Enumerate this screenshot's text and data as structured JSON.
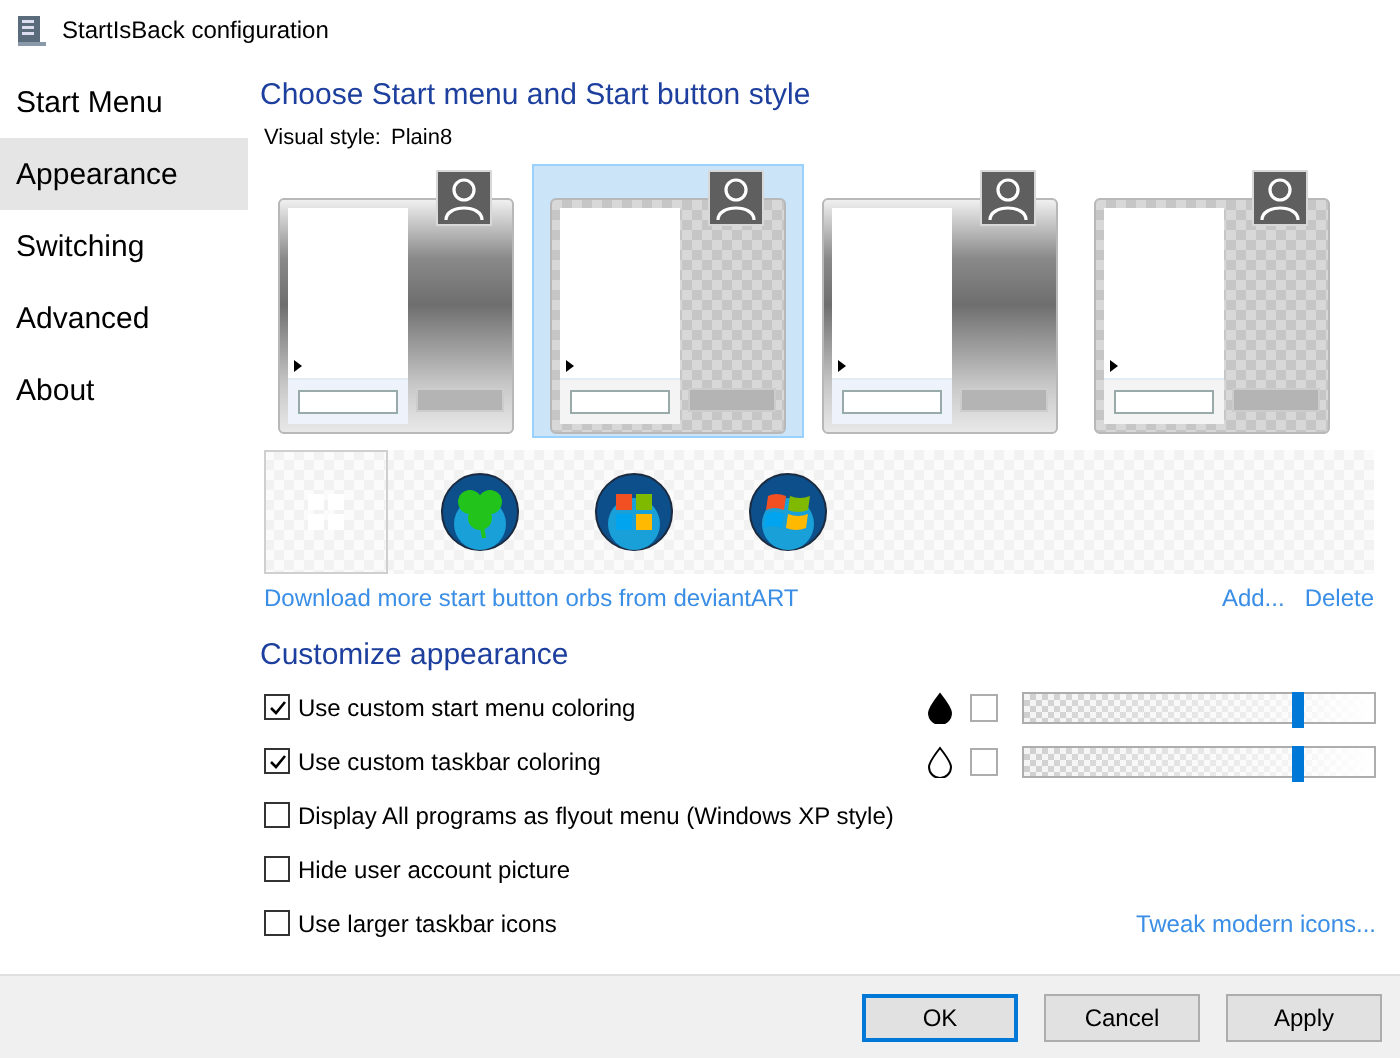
{
  "window": {
    "title": "StartIsBack configuration"
  },
  "sidebar": {
    "items": [
      {
        "label": "Start Menu",
        "selected": false
      },
      {
        "label": "Appearance",
        "selected": true
      },
      {
        "label": "Switching",
        "selected": false
      },
      {
        "label": "Advanced",
        "selected": false
      },
      {
        "label": "About",
        "selected": false
      }
    ]
  },
  "style_section": {
    "title": "Choose Start menu and Start button style",
    "visual_style_label": "Visual style:",
    "visual_style_value": "Plain8",
    "styles": [
      {
        "kind": "gradient",
        "selected": false
      },
      {
        "kind": "checker",
        "selected": true
      },
      {
        "kind": "gradient",
        "selected": false
      },
      {
        "kind": "checker",
        "selected": false
      }
    ],
    "orbs": [
      {
        "kind": "tiles",
        "selected": true
      },
      {
        "kind": "clover",
        "selected": false
      },
      {
        "kind": "flag",
        "selected": false
      },
      {
        "kind": "wave",
        "selected": false
      }
    ],
    "download_link": "Download more start button orbs from deviantART",
    "add_link": "Add...",
    "delete_link": "Delete"
  },
  "customize": {
    "title": "Customize appearance",
    "options": [
      {
        "label": "Use custom start menu coloring",
        "checked": true,
        "kind": "color",
        "drop_filled": true,
        "level": 0.78
      },
      {
        "label": "Use custom taskbar coloring",
        "checked": true,
        "kind": "color",
        "drop_filled": false,
        "level": 0.78
      },
      {
        "label": "Display All programs as flyout menu (Windows XP style)",
        "checked": false,
        "kind": "plain"
      },
      {
        "label": "Hide user account picture",
        "checked": false,
        "kind": "plain"
      },
      {
        "label": "Use larger taskbar icons",
        "checked": false,
        "kind": "link",
        "link": "Tweak modern icons..."
      }
    ]
  },
  "buttons": [
    {
      "label": "OK",
      "default": true
    },
    {
      "label": "Cancel",
      "default": false
    },
    {
      "label": "Apply",
      "default": false
    }
  ]
}
